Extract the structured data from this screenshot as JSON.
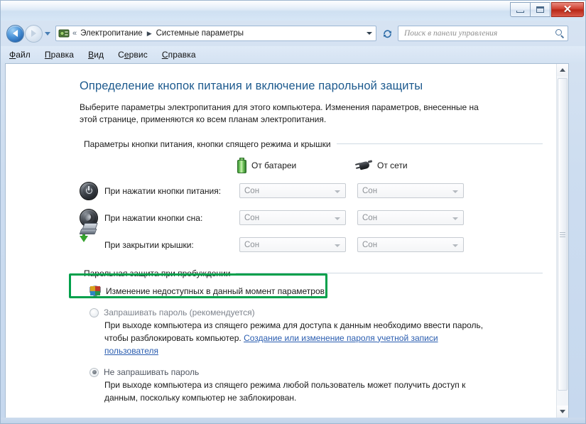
{
  "window": {
    "caption_buttons": {
      "minimize": "minimize-icon",
      "maximize": "maximize-icon",
      "close": "✕"
    }
  },
  "nav": {
    "back_icon": "back-arrow-icon",
    "forward_icon": "forward-arrow-icon",
    "history_icon": "chevron-down-icon",
    "refresh_icon": "↻",
    "breadcrumb": {
      "overflow": "«",
      "items": [
        "Электропитание",
        "Системные параметры"
      ],
      "separator": "▶"
    }
  },
  "search": {
    "placeholder": "Поиск в панели управления",
    "icon": "search-icon"
  },
  "menubar": {
    "items": [
      {
        "mnemonic": "Ф",
        "rest": "айл"
      },
      {
        "mnemonic": "П",
        "rest": "равка"
      },
      {
        "mnemonic": "В",
        "rest": "ид"
      },
      {
        "mnemonic": "С",
        "rest": "ервис",
        "pre": "С",
        "mid": "е"
      },
      {
        "mnemonic": "С",
        "rest": "правка"
      }
    ],
    "labels": [
      "Файл",
      "Правка",
      "Вид",
      "Сервис",
      "Справка"
    ]
  },
  "main": {
    "title": "Определение кнопок питания и включение парольной защиты",
    "description": "Выберите параметры электропитания для этого компьютера. Изменения параметров, внесенные на этой странице, применяются ко всем планам электропитания.",
    "buttons_group_header": "Параметры кнопки питания, кнопки спящего режима и крышки",
    "columns": [
      {
        "label": "От батареи",
        "icon": "battery-icon"
      },
      {
        "label": "От сети",
        "icon": "power-plug-icon"
      }
    ],
    "rows": [
      {
        "icon": "power-button-icon",
        "label": "При нажатии кнопки питания:",
        "battery_value": "Сон",
        "ac_value": "Сон"
      },
      {
        "icon": "sleep-moon-icon",
        "label": "При нажатии кнопки сна:",
        "battery_value": "Сон",
        "ac_value": "Сон"
      },
      {
        "icon": "laptop-lid-icon",
        "label": "При закрытии крышки:",
        "battery_value": "Сон",
        "ac_value": "Сон"
      }
    ],
    "password_group_header": "Парольная защита при пробуждении",
    "admin_link": {
      "icon": "uac-shield-icon",
      "label": "Изменение недоступных в данный момент параметров"
    },
    "radios": [
      {
        "label": "Запрашивать пароль (рекомендуется)",
        "selected": false,
        "description_before": "При выходе компьютера из спящего режима для доступа к данным необходимо ввести пароль, чтобы разблокировать компьютер. ",
        "link": "Создание или изменение пароля учетной записи пользователя",
        "description_after": ""
      },
      {
        "label": "Не запрашивать пароль",
        "selected": true,
        "description_before": "При выходе компьютера из спящего режима любой пользователь может получить доступ к данным, поскольку компьютер не заблокирован.",
        "link": "",
        "description_after": ""
      }
    ]
  },
  "annotation": {
    "highlight_color": "#00a04b",
    "target": "admin-settings-link"
  },
  "scrollbar": {
    "up_icon": "scroll-up-arrow-icon",
    "down_icon": "scroll-down-arrow-icon"
  }
}
